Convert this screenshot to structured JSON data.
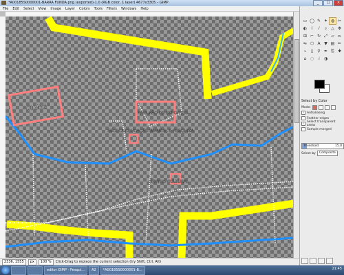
{
  "window": {
    "title": "*A00185S0000001-BARRA FUNDA.png (exported)-1.0 (RGB color, 1 layer) 4677x3305 – GIMP",
    "controls": [
      "_",
      "□",
      "×"
    ]
  },
  "menu": [
    "File",
    "Edit",
    "Select",
    "View",
    "Image",
    "Layer",
    "Colors",
    "Tools",
    "Filters",
    "Windows",
    "Help"
  ],
  "map_labels": {
    "clube": "CLUBE",
    "pavilhao": "PAVILHÃO DE ESPORTES",
    "escola": "ESCOLA EDUCAÇÃO INFANTIL E PESQUISA",
    "centro": "CENTRO CULTURAL"
  },
  "map_colors": {
    "road": "#ffff00",
    "river": "#1e90ff",
    "building": "#ff7f7f",
    "outline": "#ffffff"
  },
  "status": {
    "coords": "2336, 1555",
    "unit": "px",
    "zoom": "100 %",
    "message": "Click-Drag to replace the current selection (try Shift, Ctrl, Alt)"
  },
  "toolbox": {
    "options_title": "Select by Color",
    "mode_label": "Mode:",
    "antialiasing": "Antialiasing",
    "feather": "Feather edges",
    "transparent": "Select transparent areas",
    "sample_merged": "Sample merged",
    "threshold_label": "Threshold",
    "threshold_value": "15.0",
    "threshold_fraction": 0.12,
    "select_by_label": "Select by",
    "select_by_value": "Composite",
    "tool_icons": [
      "rect-select",
      "ellipse-select",
      "free-select",
      "fuzzy-select",
      "by-color-select",
      "scissors",
      "foreground-select",
      "paths",
      "color-picker",
      "zoom",
      "measure",
      "move",
      "align",
      "crop",
      "rotate",
      "scale",
      "shear",
      "perspective",
      "flip",
      "cage",
      "text",
      "bucket-fill",
      "blend",
      "pencil",
      "paintbrush",
      "eraser",
      "airbrush",
      "ink",
      "clone",
      "heal",
      "perspective-clone",
      "blur",
      "smudge",
      "dodge-burn"
    ]
  },
  "taskbar": {
    "items": [
      "editor GIMP - Pesqui...",
      "A2",
      "*A00185S0000001-B..."
    ],
    "time": "21:45"
  }
}
